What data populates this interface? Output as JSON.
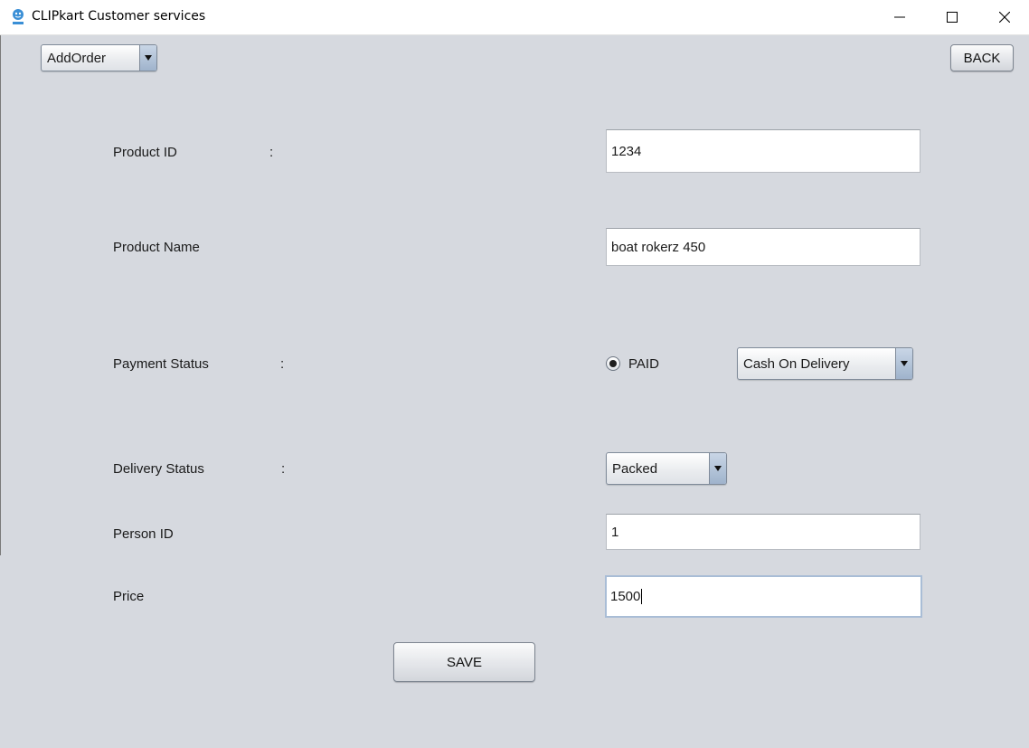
{
  "window": {
    "title": "CLIPkart Customer services",
    "icon": "clipkart-app-icon",
    "controls": [
      "minimize-icon",
      "maximize-icon",
      "close-icon"
    ]
  },
  "toolbar": {
    "menu_select": "AddOrder",
    "back_label": "BACK"
  },
  "form": {
    "product_id": {
      "label": "Product ID",
      "colon": ":",
      "value": "1234"
    },
    "product_name": {
      "label": "Product Name",
      "value": "boat rokerz 450"
    },
    "payment_status": {
      "label": "Payment Status",
      "colon": ":",
      "radio_label": "PAID",
      "radio_checked": true,
      "method": "Cash On Delivery"
    },
    "delivery_status": {
      "label": "Delivery Status",
      "colon": ":",
      "value": "Packed"
    },
    "person_id": {
      "label": "Person ID",
      "value": "1"
    },
    "price": {
      "label": "Price",
      "value": "1500"
    },
    "save_label": "SAVE"
  }
}
